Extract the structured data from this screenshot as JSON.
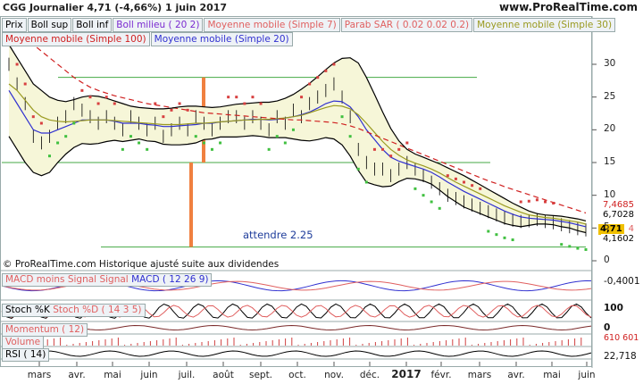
{
  "header": {
    "symbol_line": "CGG   Journalier    4,71 (-4,66%)   1 juin 2017",
    "site": "www.ProRealTime.com"
  },
  "legend_row1": [
    "Prix",
    "Boll sup",
    "Boll inf",
    "Boll milieu ( 20 2)",
    "Moyenne mobile (Simple 7)",
    "Parab SAR ( 0.02 0.02 0.2)",
    "Moyenne mobile (Simple 30)"
  ],
  "legend_row2": [
    "Moyenne mobile (Simple 100)",
    "Moyenne mobile (Simple 20)"
  ],
  "legend_colors": [
    "#000000",
    "#000000",
    "#000000",
    "#7a2ad0",
    "#e06060",
    "#e06060",
    "#9a9a20",
    "#d02020",
    "#3030d0"
  ],
  "annotation": "attendre 2.25",
  "copyright": "© ProRealTime.com Historique ajusté suite aux dividendes",
  "price_labels": {
    "a": "7,4685",
    "b": "6,7028",
    "c": "4,71",
    "d": "4,1602",
    "e": "4"
  },
  "panels": {
    "macd": {
      "legend": [
        "MACD moins Signal",
        "Signal",
        "MACD ( 12 26 9)"
      ],
      "value": "-0,4001"
    },
    "stoch": {
      "legend": [
        "Stoch %K",
        "Stoch %D ( 14 3 5)"
      ],
      "value": "100"
    },
    "momentum": {
      "legend": "Momentum ( 12)",
      "value": "0"
    },
    "volume": {
      "legend": "Volume",
      "value": "610 601"
    },
    "rsi": {
      "legend": "RSI ( 14)",
      "value": "22,718"
    }
  },
  "chart_data": {
    "type": "line",
    "title": "CGG Journalier",
    "x_labels": [
      "mars",
      "avr.",
      "mai",
      "juin",
      "juil.",
      "août",
      "sept.",
      "oct.",
      "nov.",
      "déc.",
      "2017",
      "févr.",
      "mars",
      "avr.",
      "mai",
      "juin"
    ],
    "y_ticks": [
      30,
      25,
      20,
      15,
      10,
      5,
      0
    ],
    "ylim": [
      0,
      33
    ],
    "series": [
      {
        "name": "Prix",
        "color": "#000000",
        "values": [
          30,
          27,
          24,
          19,
          18,
          19,
          21,
          22,
          24,
          23,
          22,
          21,
          22,
          21,
          20,
          22,
          21,
          20,
          21,
          19,
          20,
          21,
          20,
          22,
          21,
          20,
          21,
          22,
          22,
          21,
          22,
          21,
          20,
          22,
          21,
          23,
          22,
          24,
          25,
          26,
          27,
          25,
          22,
          17,
          15,
          14,
          14,
          13,
          14,
          15,
          14,
          13,
          12,
          11,
          10,
          9.5,
          9,
          8.5,
          8,
          7.5,
          7,
          6.5,
          6.2,
          6,
          6.1,
          6.3,
          6,
          5.8,
          5.5,
          5.2,
          4.9,
          4.71
        ]
      },
      {
        "name": "Moyenne mobile (Simple 20)",
        "color": "#3030d0",
        "values": [
          26,
          24,
          22,
          20,
          19.5,
          19.5,
          20,
          20.5,
          21,
          21.5,
          21.5,
          21.5,
          21.5,
          21.3,
          21,
          21,
          21,
          20.8,
          20.7,
          20.5,
          20.5,
          20.6,
          20.7,
          20.8,
          21,
          21,
          21.2,
          21.3,
          21.4,
          21.5,
          21.6,
          21.6,
          21.5,
          21.6,
          21.8,
          22,
          22.3,
          22.7,
          23.3,
          24,
          24.4,
          24.3,
          23.5,
          22,
          20,
          18.5,
          17,
          15.8,
          15.2,
          14.8,
          14.4,
          14,
          13.5,
          12.8,
          12,
          11.3,
          10.6,
          10,
          9.4,
          8.8,
          8.2,
          7.6,
          7.1,
          6.7,
          6.5,
          6.4,
          6.3,
          6.2,
          6,
          5.8,
          5.5,
          5.2
        ]
      },
      {
        "name": "Moyenne mobile (Simple 30)",
        "color": "#9a9a20",
        "values": [
          27,
          26,
          24.5,
          23,
          22,
          21.5,
          21.3,
          21.2,
          21.3,
          21.4,
          21.5,
          21.5,
          21.5,
          21.4,
          21.3,
          21.2,
          21.1,
          21,
          20.9,
          20.8,
          20.8,
          20.8,
          20.9,
          21,
          21,
          21.1,
          21.2,
          21.3,
          21.4,
          21.5,
          21.5,
          21.6,
          21.6,
          21.7,
          21.8,
          22,
          22.2,
          22.6,
          23,
          23.4,
          23.7,
          23.6,
          23.2,
          22.3,
          21,
          19.6,
          18.2,
          17,
          16.1,
          15.4,
          14.9,
          14.5,
          14,
          13.4,
          12.7,
          12,
          11.4,
          10.8,
          10.2,
          9.6,
          9,
          8.4,
          7.9,
          7.4,
          7,
          6.8,
          6.6,
          6.5,
          6.3,
          6.1,
          5.9,
          5.6
        ]
      },
      {
        "name": "Moyenne mobile (Simple 100)",
        "color": "#d02020",
        "values": [
          36,
          35,
          34,
          33,
          32,
          31,
          30,
          29,
          28,
          27.2,
          26.5,
          26,
          25.6,
          25.2,
          24.9,
          24.6,
          24.3,
          24,
          23.8,
          23.6,
          23.4,
          23.2,
          23,
          22.8,
          22.6,
          22.5,
          22.4,
          22.3,
          22.2,
          22.1,
          22,
          21.9,
          21.8,
          21.7,
          21.6,
          21.5,
          21.5,
          21.4,
          21.3,
          21.2,
          21.1,
          20.9,
          20.6,
          20.2,
          19.7,
          19.2,
          18.7,
          18.2,
          17.7,
          17.2,
          16.7,
          16.2,
          15.7,
          15.2,
          14.7,
          14.2,
          13.7,
          13.2,
          12.7,
          12.2,
          11.8,
          11.3,
          10.9,
          10.5,
          10.1,
          9.7,
          9.3,
          8.9,
          8.5,
          8.1,
          7.7,
          7.3
        ]
      },
      {
        "name": "Boll sup",
        "color": "#000000",
        "values": [
          33,
          31,
          29,
          27,
          26,
          25,
          24.5,
          24.3,
          24.6,
          25,
          25.2,
          25.1,
          24.8,
          24.4,
          24,
          23.6,
          23.4,
          23.3,
          23.2,
          23.2,
          23.3,
          23.5,
          23.6,
          23.6,
          23.5,
          23.4,
          23.5,
          23.7,
          23.9,
          24,
          24.1,
          24.2,
          24.2,
          24.4,
          24.8,
          25.4,
          26.2,
          27.1,
          28.1,
          29.2,
          30.2,
          30.9,
          31,
          30.2,
          28,
          25.4,
          22.7,
          20.2,
          18.3,
          17,
          16.3,
          15.8,
          15.3,
          14.8,
          14.2,
          13.6,
          13,
          12.3,
          11.6,
          10.9,
          10.2,
          9.5,
          8.8,
          8.2,
          7.6,
          7.2,
          7,
          6.9,
          6.8,
          6.6,
          6.4,
          6.1
        ]
      },
      {
        "name": "Boll inf",
        "color": "#000000",
        "values": [
          19,
          17,
          15,
          13.5,
          13,
          13.5,
          15,
          16.3,
          17.3,
          17.9,
          17.8,
          17.9,
          18.2,
          18.4,
          18.2,
          18.4,
          18.6,
          18.3,
          18.2,
          17.8,
          17.7,
          17.7,
          17.8,
          18,
          18.5,
          18.6,
          18.9,
          18.9,
          18.9,
          19,
          19.1,
          19,
          18.8,
          18.8,
          18.8,
          18.6,
          18.4,
          18.3,
          18.5,
          18.8,
          18.6,
          17.7,
          16,
          13.8,
          12,
          11.6,
          11.3,
          11.4,
          12.1,
          12.6,
          12.5,
          12.2,
          11.7,
          10.8,
          9.8,
          9,
          8.2,
          7.7,
          7.2,
          6.7,
          6.2,
          5.7,
          5.4,
          5.2,
          5.4,
          5.6,
          5.6,
          5.5,
          5.2,
          5,
          4.6,
          4.3
        ]
      }
    ],
    "sar_color": "#d84040",
    "sar_up_color": "#40c040"
  }
}
